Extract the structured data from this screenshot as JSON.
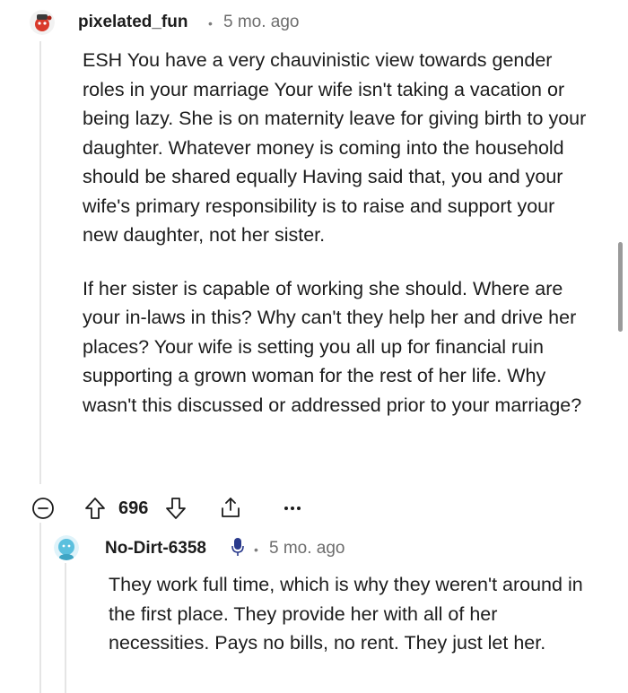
{
  "comment": {
    "username": "pixelated_fun",
    "separator": "•",
    "time": "5 mo. ago",
    "paragraphs": [
      "ESH You have a very chauvinistic view towards gender roles in your marriage Your wife isn't taking a vacation or being lazy. She is on maternity leave for giving birth to your daughter. Whatever money is coming into the household should be shared equally Having said that, you and your wife's primary responsibility is to raise and support your new daughter, not her sister.",
      "If her sister is capable of working she should. Where are your in-laws in this? Why can't they help her and drive her places? Your wife is setting you all up for financial ruin supporting a grown woman for the rest of her life. Why wasn't this discussed or addressed prior to your marriage?"
    ],
    "score": "696"
  },
  "reply": {
    "username": "No-Dirt-6358",
    "separator": "•",
    "time": "5 mo. ago",
    "text": "They work full time, which is why they weren't around in the first place. They provide her with all of her necessities. Pays no bills, no rent. They just let her."
  },
  "icons": {
    "collapse": "minus-circle-icon",
    "upvote": "arrow-up-outline-icon",
    "downvote": "arrow-down-outline-icon",
    "share": "share-icon",
    "more": "ellipsis-icon",
    "mic": "microphone-icon"
  },
  "colors": {
    "text": "#1c1c1c",
    "meta": "#6d6d6d",
    "thread_line": "#e5e5e5",
    "reply_avatar": "#5bc0de"
  }
}
